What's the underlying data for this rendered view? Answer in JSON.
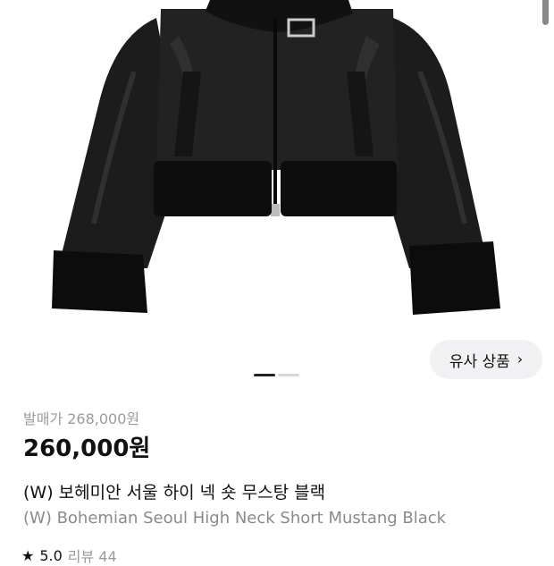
{
  "product": {
    "image_alt": "black faux leather mustang jacket with fur trim",
    "similar_button_label": "유사 상품",
    "similar_button_icon": "chevron-right-icon",
    "carousel": {
      "count": 2,
      "active_index": 0
    },
    "original_price": "발매가 268,000원",
    "price": "260,000원",
    "name_ko": "(W) 보헤미안 서울 하이 넥 숏 무스탕 블랙",
    "name_en": "(W) Bohemian Seoul High Neck Short Mustang Black",
    "rating": "5.0",
    "reviews": "리뷰 44"
  },
  "colors": {
    "accent_text": "#111111",
    "muted_text": "#9b9b9b",
    "button_bg": "#f1f1f3"
  }
}
